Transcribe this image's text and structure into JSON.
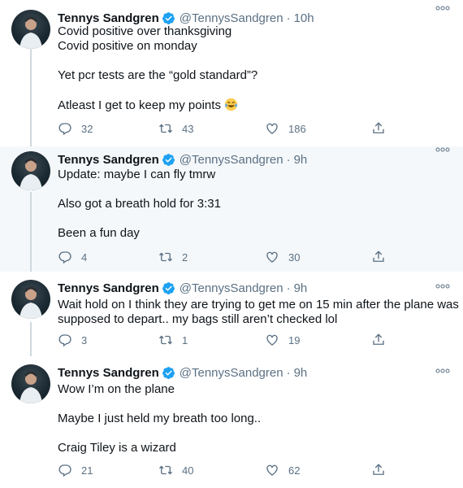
{
  "accent_color": "#1da1f2",
  "muted_color": "#5b7083",
  "tweets": [
    {
      "author": "Tennys Sandgren",
      "handle": "@TennysSandgren",
      "separator": "·",
      "time": "10h",
      "verified": true,
      "lines": [
        "Covid positive over thanksgiving",
        "Covid positive on monday",
        "",
        "Yet pcr tests are the “gold standard”?",
        "",
        "Atleast I get to keep my points"
      ],
      "emoji": "face-with-tears-of-joy",
      "replies": "32",
      "retweets": "43",
      "likes": "186"
    },
    {
      "author": "Tennys Sandgren",
      "handle": "@TennysSandgren",
      "separator": "·",
      "time": "9h",
      "verified": true,
      "lines": [
        "Update: maybe I can fly tmrw",
        "",
        "Also got a breath hold for 3:31",
        "",
        "Been a fun day"
      ],
      "replies": "4",
      "retweets": "2",
      "likes": "30"
    },
    {
      "author": "Tennys Sandgren",
      "handle": "@TennysSandgren",
      "separator": "·",
      "time": "9h",
      "verified": true,
      "lines": [
        "Wait hold on I think they are trying to get me on 15 min after the plane was",
        "supposed to depart.. my bags still aren’t checked lol"
      ],
      "replies": "3",
      "retweets": "1",
      "likes": "19"
    },
    {
      "author": "Tennys Sandgren",
      "handle": "@TennysSandgren",
      "separator": "·",
      "time": "9h",
      "verified": true,
      "lines": [
        "Wow I’m on the plane",
        "",
        "Maybe I just held my breath too long..",
        "",
        "Craig Tiley is a wizard"
      ],
      "replies": "21",
      "retweets": "40",
      "likes": "62"
    }
  ]
}
